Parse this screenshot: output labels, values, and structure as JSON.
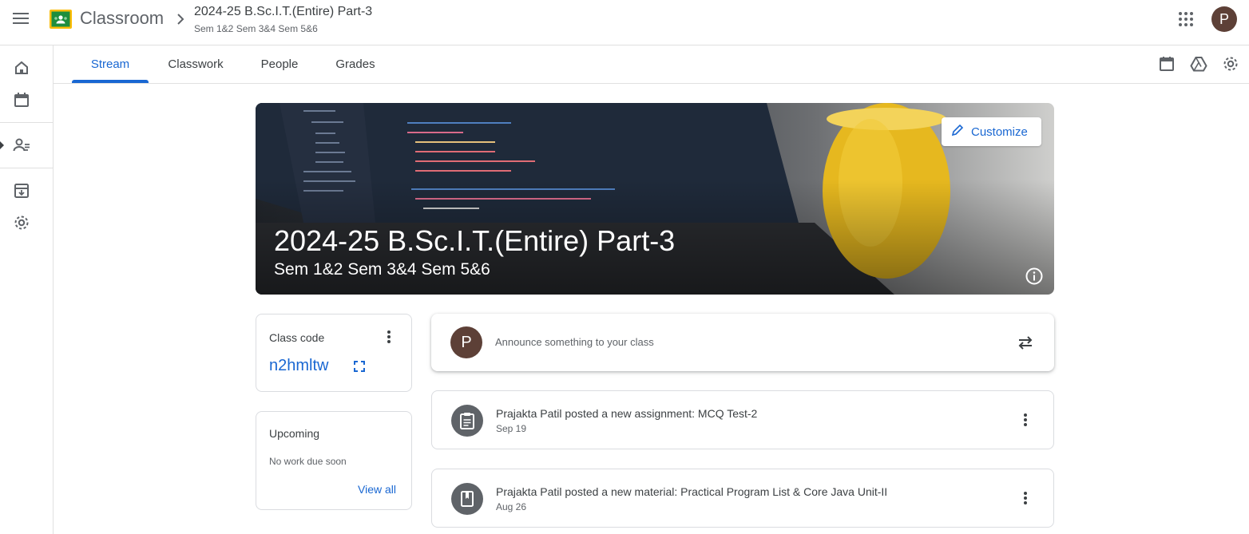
{
  "app": {
    "name": "Classroom"
  },
  "breadcrumb": {
    "title": "2024-25 B.Sc.I.T.(Entire) Part-3",
    "subtitle": "Sem 1&2 Sem 3&4 Sem 5&6"
  },
  "user": {
    "initial": "P"
  },
  "tabs": [
    {
      "label": "Stream",
      "active": true
    },
    {
      "label": "Classwork",
      "active": false
    },
    {
      "label": "People",
      "active": false
    },
    {
      "label": "Grades",
      "active": false
    }
  ],
  "banner": {
    "title": "2024-25 B.Sc.I.T.(Entire) Part-3",
    "subtitle": "Sem 1&2 Sem 3&4 Sem 5&6",
    "customize_label": "Customize"
  },
  "class_code": {
    "label": "Class code",
    "value": "n2hmltw"
  },
  "upcoming": {
    "title": "Upcoming",
    "empty_text": "No work due soon",
    "view_all": "View all"
  },
  "announce": {
    "avatar_initial": "P",
    "placeholder": "Announce something to your class"
  },
  "posts": [
    {
      "icon": "assignment-icon",
      "title": "Prajakta Patil posted a new assignment: MCQ Test-2",
      "date": "Sep 19"
    },
    {
      "icon": "material-icon",
      "title": "Prajakta Patil posted a new material: Practical Program List & Core Java Unit-II",
      "date": "Aug 26"
    }
  ],
  "colors": {
    "accent": "#1967d2",
    "avatar": "#5d4037",
    "border": "#dadce0"
  }
}
